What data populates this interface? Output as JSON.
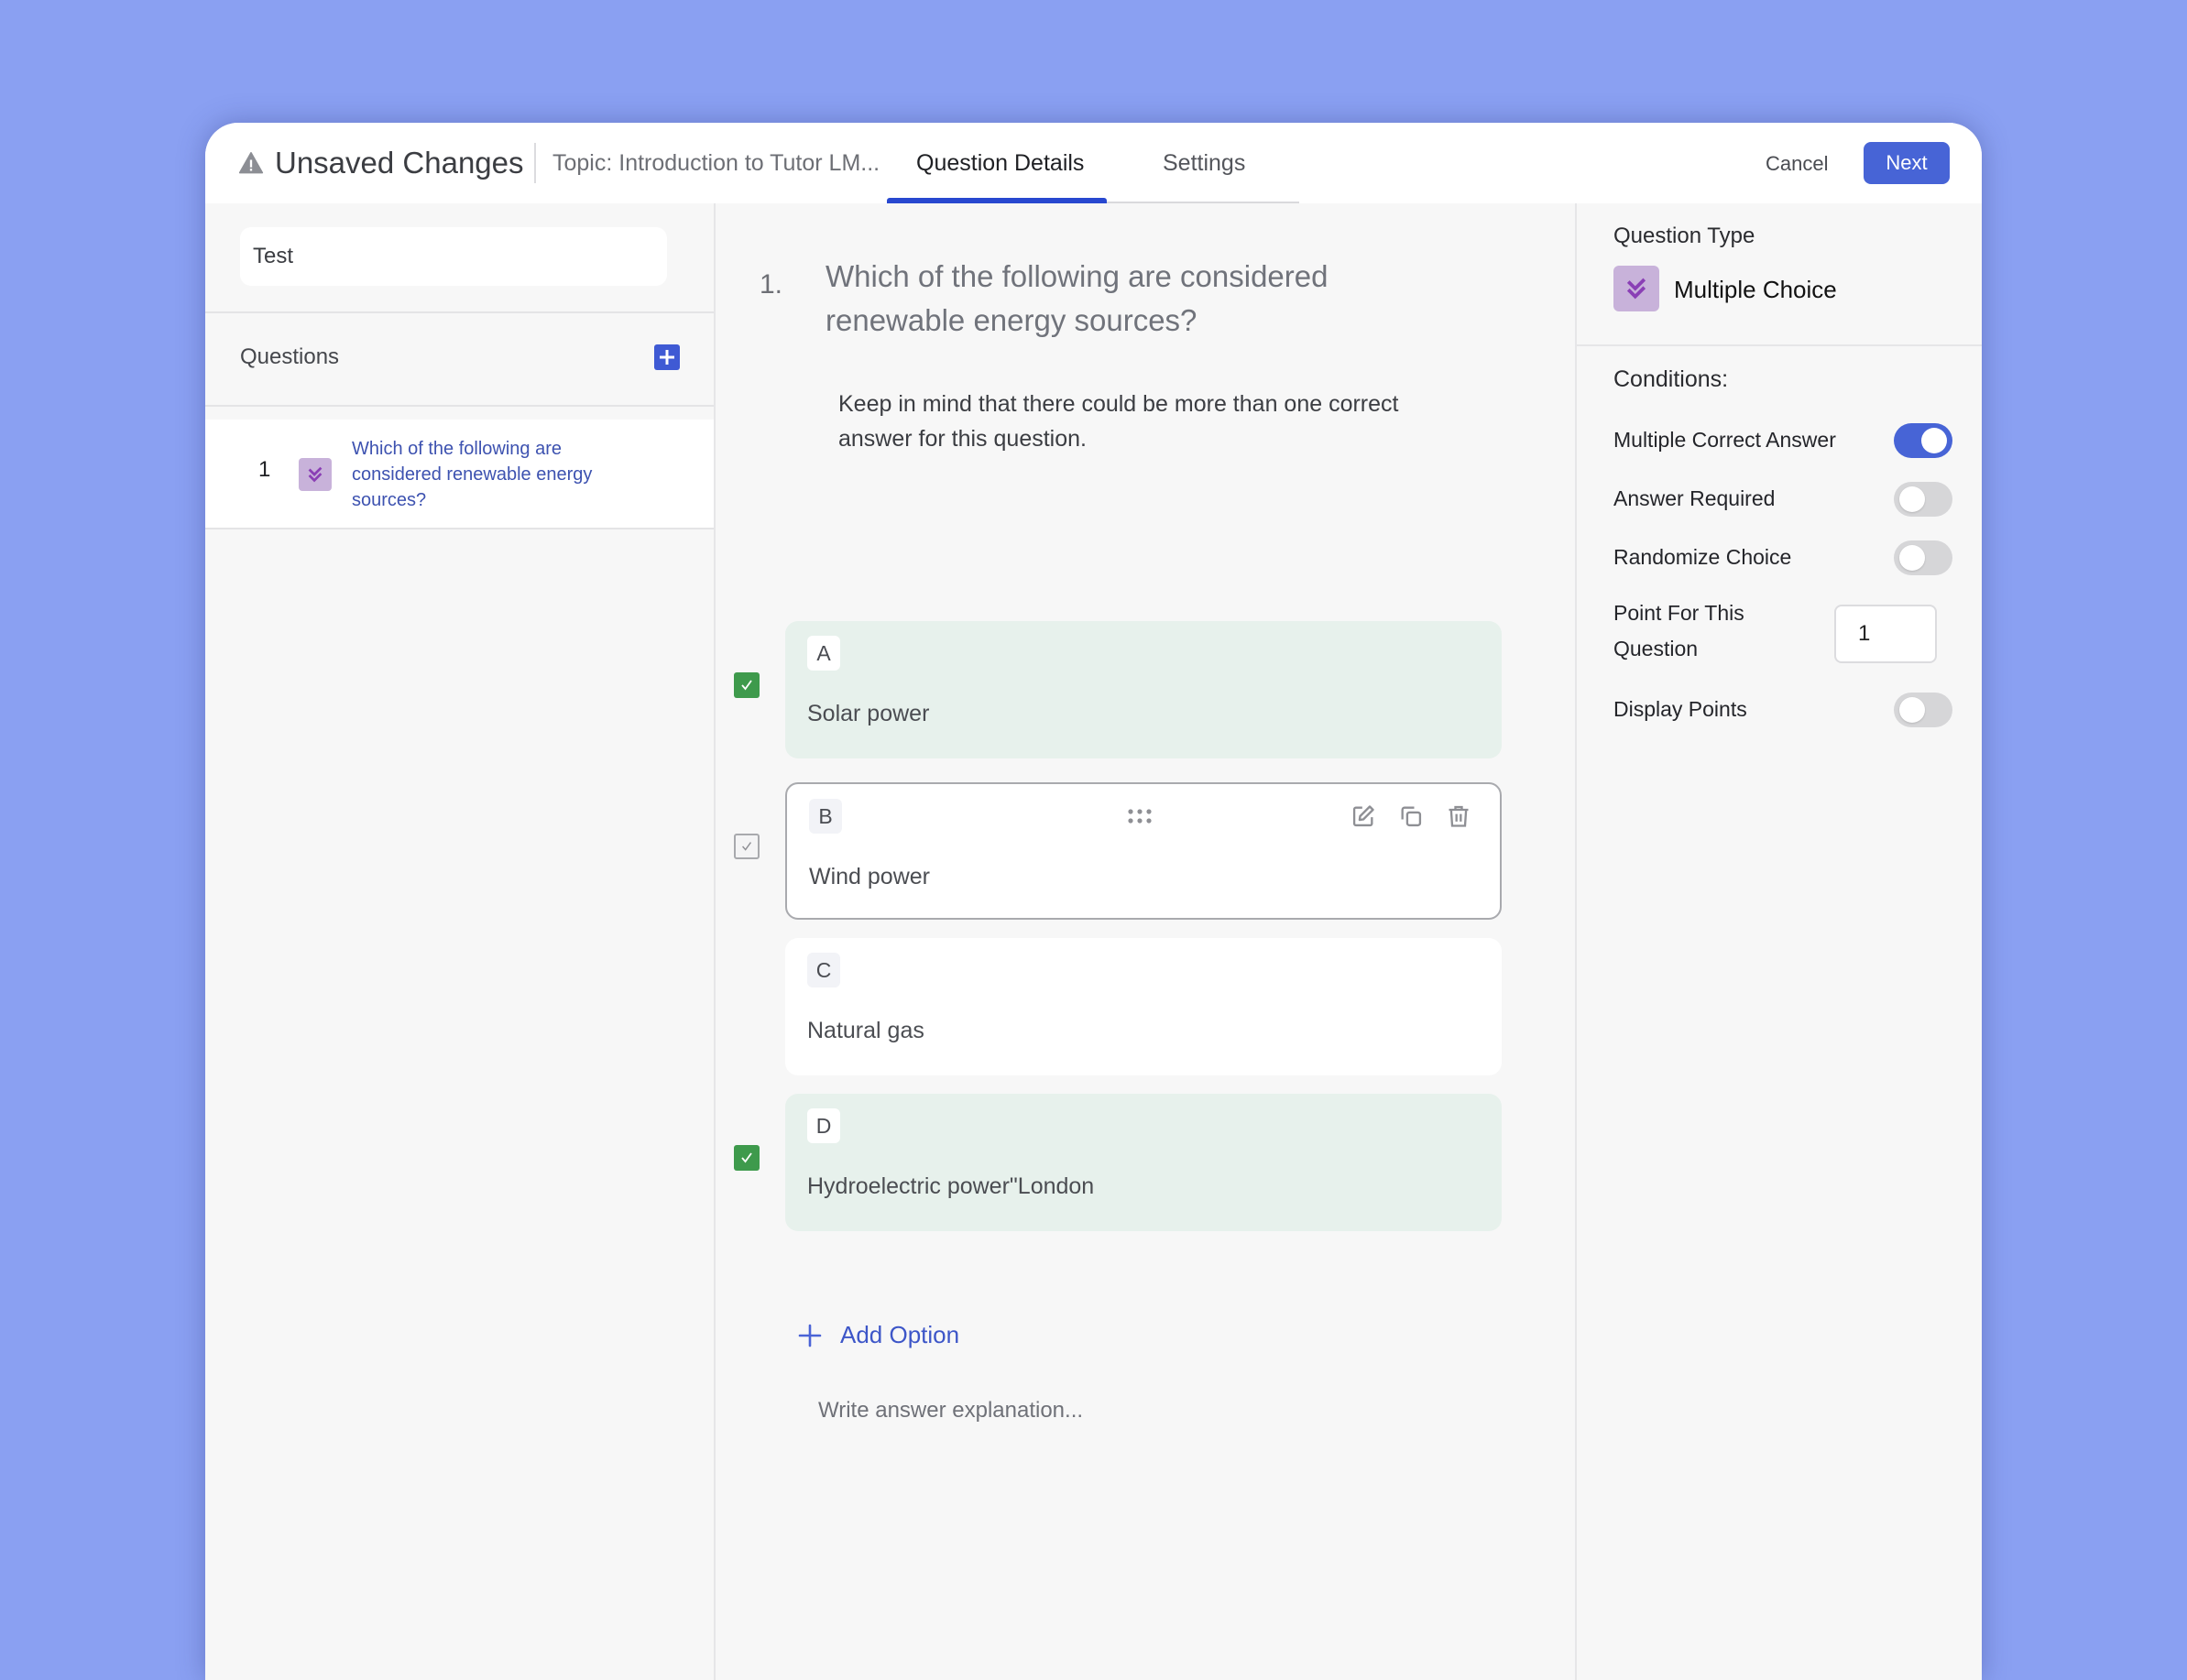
{
  "header": {
    "status": "Unsaved Changes",
    "status_icon": "warning-icon",
    "topic": "Topic: Introduction to Tutor LM...",
    "tabs": [
      {
        "label": "Question Details",
        "active": true
      },
      {
        "label": "Settings",
        "active": false
      }
    ],
    "cancel_label": "Cancel",
    "next_label": "Next"
  },
  "sidebar": {
    "quiz_name_value": "Test",
    "questions_label": "Questions",
    "add_icon": "plus-icon",
    "items": [
      {
        "number": "1",
        "type_icon": "double-check-icon",
        "text": "Which of the following are considered renewable energy sources?"
      }
    ]
  },
  "question": {
    "number": "1.",
    "title": "Which of the following are considered renewable energy sources?",
    "hint": "Keep in mind that there could be more than one correct answer for this question.",
    "options": [
      {
        "letter": "A",
        "text": "Solar power",
        "correct": true
      },
      {
        "letter": "B",
        "text": "Wind power",
        "correct": false
      },
      {
        "letter": "C",
        "text": "Natural gas",
        "correct": false
      },
      {
        "letter": "D",
        "text": "Hydroelectric power\"London",
        "correct": true
      }
    ],
    "option_tools": [
      "edit-icon",
      "copy-icon",
      "trash-icon"
    ],
    "add_option_label": "Add Option",
    "explanation_placeholder": "Write answer explanation..."
  },
  "settings": {
    "question_type_label": "Question Type",
    "question_type_value": "Multiple Choice",
    "conditions_label": "Conditions:",
    "conditions": [
      {
        "label": "Multiple Correct Answer",
        "on": true
      },
      {
        "label": "Answer Required",
        "on": false
      },
      {
        "label": "Randomize Choice",
        "on": false
      }
    ],
    "points_label": "Point For This Question",
    "points_value": "1",
    "display_points_label": "Display Points",
    "display_points_on": false
  },
  "colors": {
    "accent": "#4764d6",
    "correct_green": "#3e9a4c",
    "correct_bg": "#e7f1ec",
    "type_icon_bg": "#c8b2da",
    "background": "#8aa0f2"
  }
}
